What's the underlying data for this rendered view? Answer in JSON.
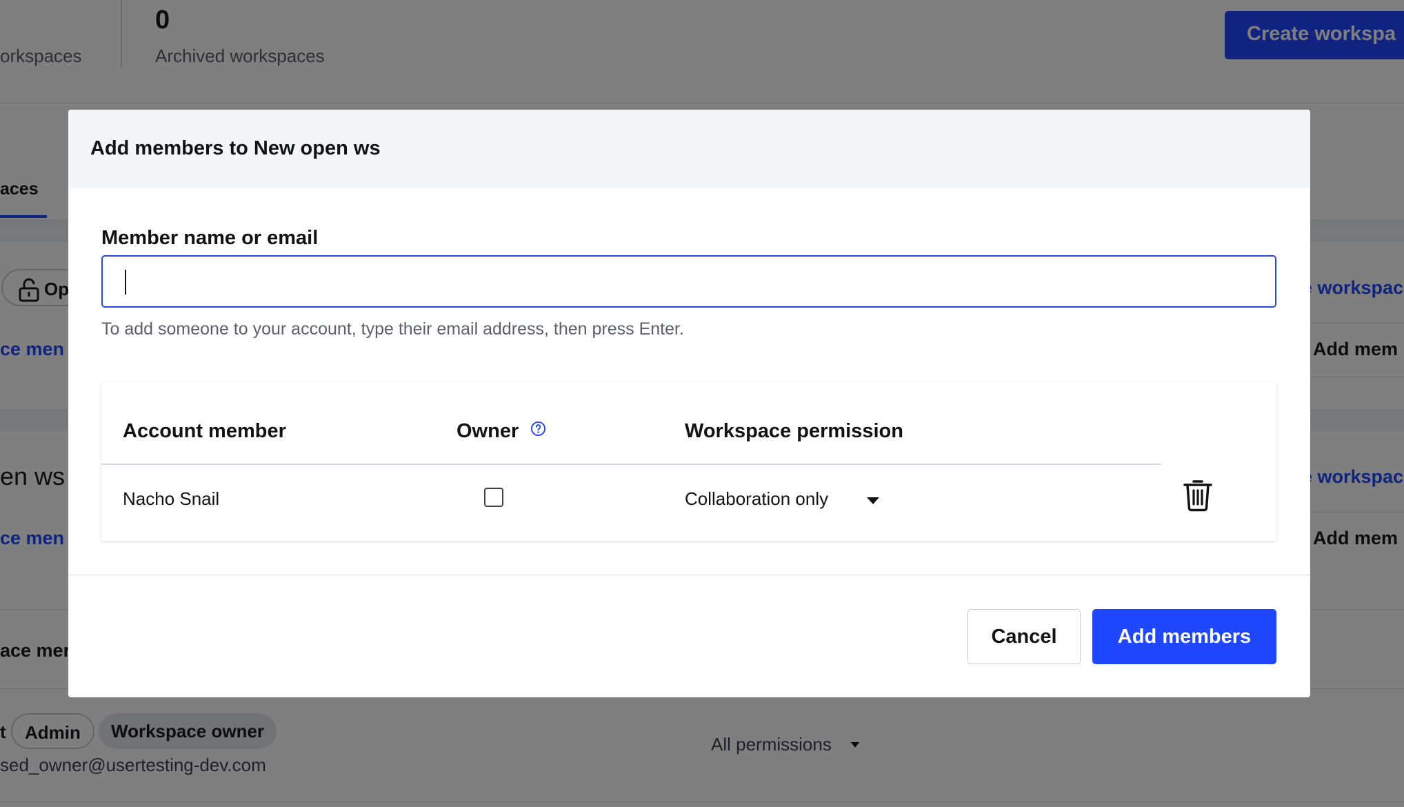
{
  "background": {
    "stats": [
      {
        "number": "",
        "label": "orkspaces"
      },
      {
        "number": "0",
        "label": "Archived workspaces"
      }
    ],
    "create_button": "Create workspa",
    "tab_label": "aces",
    "open_badge": "Op",
    "workspace_link": "e workspace",
    "manage_link": "ce men",
    "add_members_link": "Add mem",
    "second_title": "en ws",
    "third_text": "ace mer",
    "row_prefix": "t",
    "badges": [
      "Admin",
      "Workspace owner"
    ],
    "email": "sed_owner@usertesting-dev.com",
    "permission": "All permissions"
  },
  "modal": {
    "title": "Add members to New open ws",
    "field_label": "Member name or email",
    "field_value": "",
    "helper_text": "To add someone to your account, type their email address, then press Enter.",
    "table": {
      "headers": {
        "member": "Account member",
        "owner": "Owner",
        "permission": "Workspace permission"
      },
      "rows": [
        {
          "name": "Nacho Snail",
          "owner": false,
          "permission": "Collaboration only"
        }
      ]
    },
    "cancel_label": "Cancel",
    "add_label": "Add members"
  },
  "colors": {
    "accent": "#1f47ff",
    "overlay": "rgba(0,0,0,0.5)",
    "header_bg": "#f3f5f8"
  },
  "icons": [
    "lock-icon",
    "help-circle-icon",
    "chevron-down-icon",
    "trash-icon"
  ]
}
